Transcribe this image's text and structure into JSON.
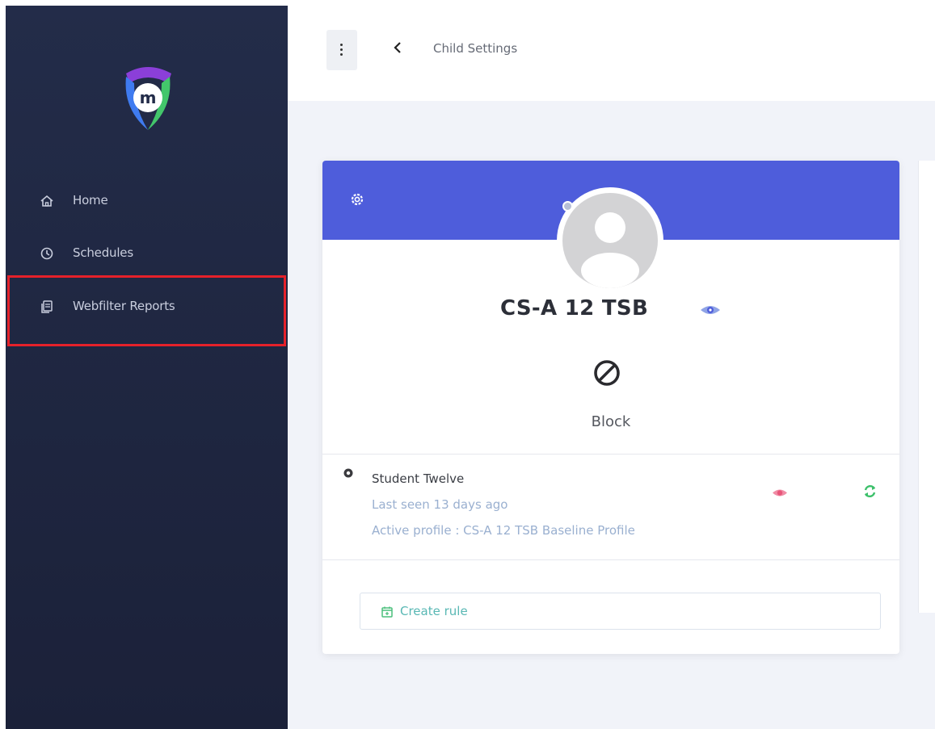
{
  "sidebar": {
    "logo_letter": "m",
    "items": [
      {
        "label": "Home",
        "icon": "home-icon"
      },
      {
        "label": "Schedules",
        "icon": "clock-icon"
      },
      {
        "label": "Webfilter Reports",
        "icon": "reports-icon"
      }
    ]
  },
  "topbar": {
    "breadcrumb": "Child Settings"
  },
  "card": {
    "child_name": "CS-A 12 TSB",
    "status_label": "Block",
    "device": {
      "name": "Student Twelve",
      "last_seen": "Last seen 13 days ago",
      "active_profile": "Active profile : CS-A 12 TSB Baseline Profile"
    },
    "create_rule_label": "Create rule"
  },
  "colors": {
    "sidebar_bg": "#1e2540",
    "card_header": "#4e5ddb",
    "highlight_border": "#e5212a",
    "eye_red": "#e8577a",
    "sync_green": "#3cc06a",
    "rule_teal": "#59b8b4"
  }
}
